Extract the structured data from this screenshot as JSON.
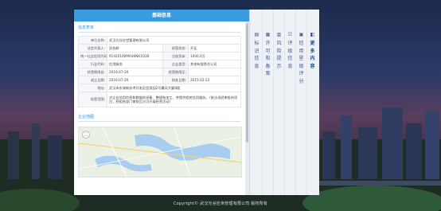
{
  "panel": {
    "title": "基础信息",
    "info_section_title": "信息表单",
    "map_section_title": "企业地图",
    "rows": [
      {
        "k1": "单位全称:",
        "v1": "武汉光谷应世管理有限公司",
        "k2": "",
        "v2": ""
      },
      {
        "k1": "法定代表人:",
        "v1": "邓佐辉",
        "k2": "经营状态:",
        "v2": "开业"
      },
      {
        "k1": "统一社会信用代码:",
        "v1": "91420100MA4KNK1Q36",
        "k2": "注册资本:",
        "v2": "1000.0万"
      },
      {
        "k1": "行业代码:",
        "v1": "信用服务",
        "k2": "企业类型:",
        "v2": "其他有限责任公司"
      },
      {
        "k1": "经营期限自:",
        "v1": "2016-07-26",
        "k2": "经营期限至:",
        "v2": ""
      },
      {
        "k1": "成立日期:",
        "v1": "2016-07-26",
        "k2": "核准日期:",
        "v2": "2015-02-22"
      },
      {
        "k1": "地址:",
        "v1": "武汉市东湖新技术开发区信用园2号幕风大厦8楼",
        "k2": "",
        "v2": ""
      },
      {
        "k1": "经营范围:",
        "v1": "对企业信用信息和数据的采集、整理和加工、并提供相关信用服务。（依法须经审批的项目，经相关部门审批后方可开展经营活动）",
        "k2": "",
        "v2": ""
      }
    ]
  },
  "side_menu": [
    {
      "label": "标识信息",
      "icon": "id-card-icon"
    },
    {
      "label": "许可和备案",
      "icon": "license-icon"
    },
    {
      "label": "风险提示",
      "icon": "warning-icon"
    },
    {
      "label": "评级信息",
      "icon": "rating-icon"
    },
    {
      "label": "信用星级评分",
      "icon": "star-icon"
    },
    {
      "label": "更多内容",
      "icon": "more-icon"
    }
  ],
  "footer": {
    "text": "Copyright© 武汉光谷应世管理有限公司 版权所有"
  }
}
